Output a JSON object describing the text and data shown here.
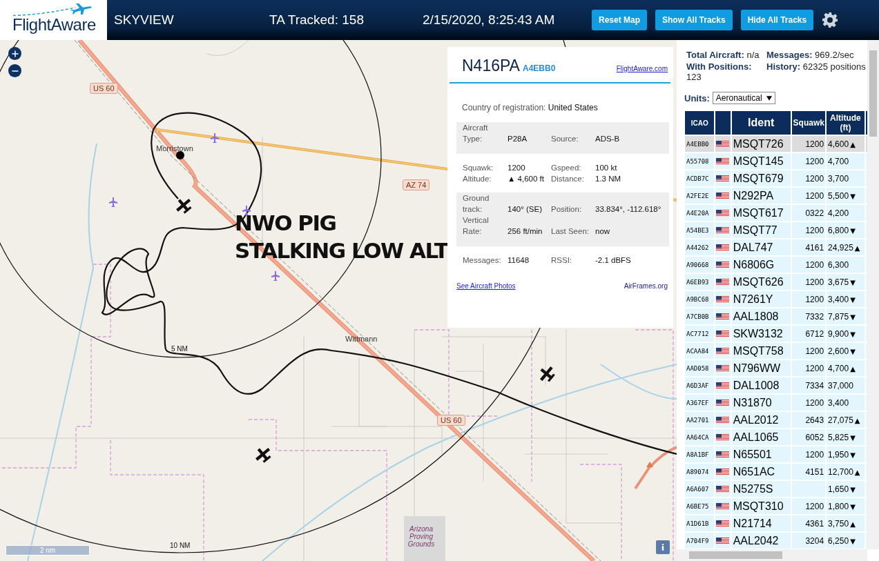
{
  "header": {
    "logo": "FlightAware",
    "title": "SKYVIEW",
    "tracked": "TA Tracked: 158",
    "datetime": "2/15/2020, 8:25:43 AM",
    "buttons": [
      "Reset Map",
      "Show All Tracks",
      "Hide All Tracks"
    ]
  },
  "map": {
    "labels": [
      {
        "text": "US 60",
        "kind": "shield"
      },
      {
        "text": "Morristown",
        "kind": "place"
      },
      {
        "text": "AZ 74",
        "kind": "shield"
      },
      {
        "text": "Wittmann",
        "kind": "place"
      },
      {
        "text": "5 NM",
        "kind": "ring"
      },
      {
        "text": "US 60",
        "kind": "shield"
      },
      {
        "text": "10 NM",
        "kind": "ring"
      },
      {
        "text": "Arizona Proving Grounds",
        "kind": "area"
      }
    ],
    "annotation": [
      "NWO PIG",
      "STALKING LOW ALT"
    ],
    "scale": "2 nm"
  },
  "popup": {
    "ident": "N416PA",
    "hex": "A4EBB0",
    "link": "FlightAware.com",
    "country_label": "Country of registration:",
    "country": "United States",
    "sections": [
      {
        "shaded": true,
        "fields": [
          {
            "label": "Aircraft Type:",
            "value": "P28A"
          },
          {
            "label": "Source:",
            "value": "ADS-B"
          }
        ]
      },
      {
        "shaded": false,
        "fields": [
          {
            "label": "Squawk:",
            "value": "1200"
          },
          {
            "label": "Gspeed:",
            "value": "100 kt"
          },
          {
            "label": "Altitude:",
            "value": "▲ 4,600 ft"
          },
          {
            "label": "Distance:",
            "value": "1.3 NM"
          }
        ]
      },
      {
        "shaded": true,
        "fields": [
          {
            "label": "Ground track:",
            "value": "140° (SE)"
          },
          {
            "label": "Position:",
            "value": "33.834°, -112.618°"
          },
          {
            "label": "Vertical Rate:",
            "value": "256 ft/min"
          },
          {
            "label": "Last Seen:",
            "value": "now"
          }
        ]
      },
      {
        "shaded": false,
        "fields": [
          {
            "label": "Messages:",
            "value": "11648"
          },
          {
            "label": "RSSI:",
            "value": "-2.1 dBFS"
          }
        ]
      }
    ],
    "photos_link": "See Aircraft Photos",
    "airframes_link": "AirFrames.org"
  },
  "stats": [
    {
      "label": "Total Aircraft:",
      "value": "n/a"
    },
    {
      "label": "Messages:",
      "value": "969.2/sec"
    },
    {
      "label": "With Positions:",
      "value": "123"
    },
    {
      "label": "History:",
      "value": "62325 positions"
    }
  ],
  "units": {
    "label": "Units:",
    "value": "Aeronautical"
  },
  "table": {
    "columns": [
      "ICAO",
      "Ident",
      "Squawk",
      "Altitude (ft)"
    ],
    "rows": [
      {
        "icao": "A4EBB0",
        "ident": "MSQT726",
        "squawk": "1200",
        "altitude": "4,600",
        "trend": "▲",
        "selected": true
      },
      {
        "icao": "A55708",
        "ident": "MSQT145",
        "squawk": "1200",
        "altitude": "4,700",
        "selected": false
      },
      {
        "icao": "ACDB7C",
        "ident": "MSQT679",
        "squawk": "1200",
        "altitude": "3,700",
        "selected": false
      },
      {
        "icao": "A2FE2E",
        "ident": "N292PA",
        "squawk": "1200",
        "altitude": "5,500",
        "trend": "▼",
        "selected": false
      },
      {
        "icao": "A4E20A",
        "ident": "MSQT617",
        "squawk": "0322",
        "altitude": "4,200",
        "selected": false
      },
      {
        "icao": "A54BE3",
        "ident": "MSQT77",
        "squawk": "1200",
        "altitude": "6,800",
        "trend": "▼",
        "selected": false
      },
      {
        "icao": "A44262",
        "ident": "DAL747",
        "squawk": "4161",
        "altitude": "24,925",
        "trend": "▲",
        "selected": false
      },
      {
        "icao": "A90668",
        "ident": "N6806G",
        "squawk": "1200",
        "altitude": "6,300",
        "selected": false
      },
      {
        "icao": "A6EB93",
        "ident": "MSQT626",
        "squawk": "1200",
        "altitude": "3,675",
        "trend": "▼",
        "selected": false
      },
      {
        "icao": "A9BC68",
        "ident": "N7261Y",
        "squawk": "1200",
        "altitude": "3,400",
        "trend": "▼",
        "selected": false
      },
      {
        "icao": "A7CB0B",
        "ident": "AAL1808",
        "squawk": "7332",
        "altitude": "7,875",
        "trend": "▼",
        "selected": false
      },
      {
        "icao": "AC7712",
        "ident": "SKW3132",
        "squawk": "6712",
        "altitude": "9,900",
        "trend": "▼",
        "selected": false
      },
      {
        "icao": "ACAA84",
        "ident": "MSQT758",
        "squawk": "1200",
        "altitude": "2,600",
        "trend": "▼",
        "selected": false
      },
      {
        "icao": "AAD058",
        "ident": "N796WW",
        "squawk": "1200",
        "altitude": "4,700",
        "trend": "▲",
        "selected": false
      },
      {
        "icao": "A6D3AF",
        "ident": "DAL1008",
        "squawk": "7334",
        "altitude": "37,000",
        "selected": false
      },
      {
        "icao": "A367EF",
        "ident": "N31870",
        "squawk": "1200",
        "altitude": "3,400",
        "selected": false
      },
      {
        "icao": "AA2701",
        "ident": "AAL2012",
        "squawk": "2643",
        "altitude": "27,075",
        "trend": "▲",
        "selected": false
      },
      {
        "icao": "AA64CA",
        "ident": "AAL1065",
        "squawk": "6052",
        "altitude": "5,825",
        "trend": "▼",
        "selected": false
      },
      {
        "icao": "A8A1BF",
        "ident": "N65501",
        "squawk": "1200",
        "altitude": "1,950",
        "trend": "▼",
        "selected": false
      },
      {
        "icao": "A89074",
        "ident": "N651AC",
        "squawk": "4151",
        "altitude": "12,700",
        "trend": "▲",
        "selected": false
      },
      {
        "icao": "A6A607",
        "ident": "N5275S",
        "altitude": "1,650",
        "trend": "▼",
        "selected": false
      },
      {
        "icao": "A6BE75",
        "ident": "MSQT310",
        "squawk": "1200",
        "altitude": "1,800",
        "trend": "▼",
        "selected": false
      },
      {
        "icao": "A1D61B",
        "ident": "N21714",
        "squawk": "4361",
        "altitude": "3,750",
        "trend": "▲",
        "selected": false
      },
      {
        "icao": "A704F9",
        "ident": "AAL2042",
        "squawk": "3204",
        "altitude": "6,250",
        "trend": "▼",
        "selected": false
      }
    ]
  }
}
